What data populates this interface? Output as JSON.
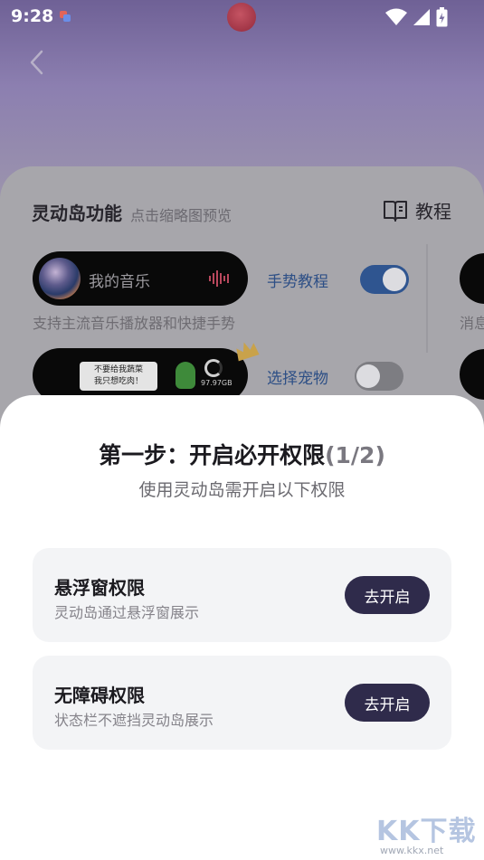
{
  "status_bar": {
    "time": "9:28"
  },
  "background": {
    "section_title": "灵动岛功能",
    "section_subtitle": "点击缩略图预览",
    "tutorial_label": "教程",
    "music_track": "我的音乐",
    "music_desc": "支持主流音乐播放器和快捷手势",
    "gesture_link": "手势教程",
    "gesture_toggle_on": true,
    "pet_speech": [
      "不要给我蔬菜",
      "我只想吃肉！"
    ],
    "pet_value": "97.97GB",
    "pet_link": "选择宠物",
    "pet_toggle_on": false,
    "side_desc": "消息"
  },
  "sheet": {
    "title": "第一步：开启必开权限",
    "step": "(1/2)",
    "subtitle": "使用灵动岛需开启以下权限",
    "permissions": [
      {
        "name": "悬浮窗权限",
        "desc": "灵动岛通过悬浮窗展示",
        "button": "去开启"
      },
      {
        "name": "无障碍权限",
        "desc": "状态栏不遮挡灵动岛展示",
        "button": "去开启"
      }
    ]
  },
  "watermark": {
    "logo": "KK下载",
    "url": "www.kkx.net"
  },
  "colors": {
    "accent_button": "#2f2b4b",
    "toggle_on": "#2f5590",
    "link": "#2d4f86"
  }
}
